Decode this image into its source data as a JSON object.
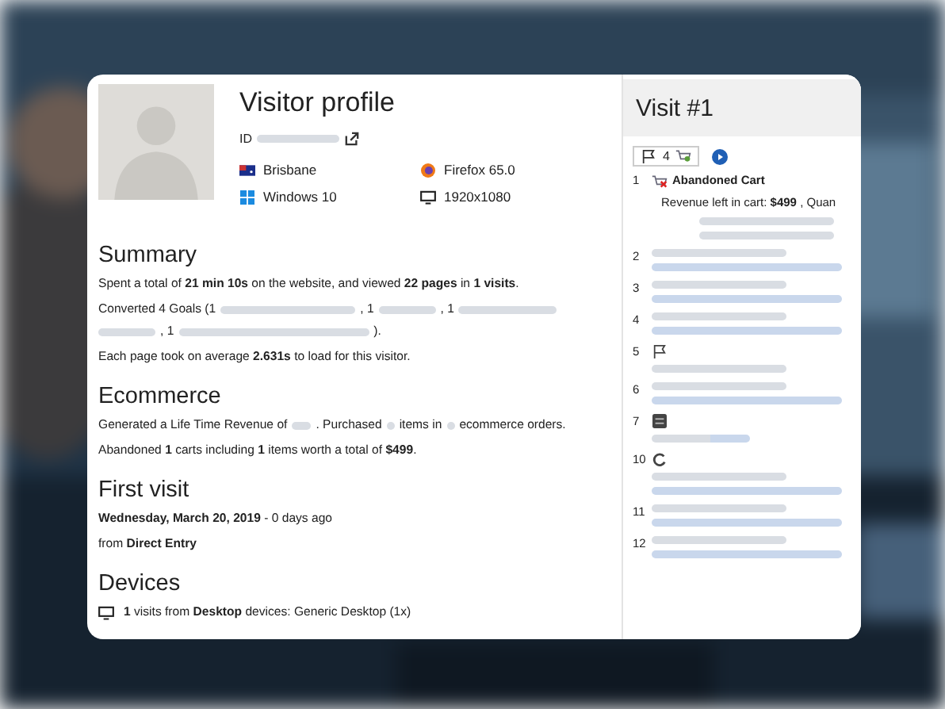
{
  "profile": {
    "title": "Visitor profile",
    "id_label": "ID",
    "location": "Brisbane",
    "browser": "Firefox 65.0",
    "os": "Windows 10",
    "resolution": "1920x1080"
  },
  "sections": [
    {
      "title": "Summary",
      "lines": [
        {
          "kind": "plain",
          "parts": [
            {
              "kind": "text",
              "text": "Spent a total of **21 min 10s** on the website, and viewed **22 pages** in **1 visits**."
            }
          ]
        },
        {
          "kind": "plain",
          "parts": [
            {
              "kind": "text",
              "text": "Converted 4 Goals (1"
            },
            {
              "kind": "redacted"
            },
            {
              "kind": "text",
              "text": ", 1"
            },
            {
              "kind": "redacted"
            },
            {
              "kind": "text",
              "text": ", 1"
            },
            {
              "kind": "redacted"
            },
            {
              "kind": "redacted"
            },
            {
              "kind": "text",
              "text": ", 1"
            },
            {
              "kind": "redacted"
            },
            {
              "kind": "text",
              "text": ")."
            }
          ]
        },
        {
          "kind": "plain",
          "parts": [
            {
              "kind": "text",
              "text": "Each page took on average **2.631s** to load for this visitor."
            }
          ]
        }
      ]
    },
    {
      "title": "Ecommerce",
      "lines": [
        {
          "kind": "plain",
          "parts": [
            {
              "kind": "text",
              "text": "Generated a Life Time Revenue of"
            },
            {
              "kind": "redacted"
            },
            {
              "kind": "text",
              "text": ". Purchased"
            },
            {
              "kind": "redacted"
            },
            {
              "kind": "text",
              "text": "items in"
            },
            {
              "kind": "redacted"
            },
            {
              "kind": "text",
              "text": "ecommerce orders."
            }
          ]
        },
        {
          "kind": "plain",
          "parts": [
            {
              "kind": "text",
              "text": "Abandoned **1** carts including **1** items worth a total of **$499**."
            }
          ]
        }
      ]
    },
    {
      "title": "First visit",
      "lines": [
        {
          "kind": "plain",
          "parts": [
            {
              "kind": "text",
              "text": "**Wednesday, March 20, 2019** - 0 days ago"
            }
          ]
        },
        {
          "kind": "plain",
          "parts": [
            {
              "kind": "text",
              "text": "from **Direct Entry**"
            }
          ]
        }
      ]
    },
    {
      "title": "Devices",
      "lines": [
        {
          "kind": "device",
          "parts": [
            {
              "kind": "text",
              "text": "**1** visits from **Desktop** devices: Generic Desktop (1x)"
            }
          ]
        }
      ]
    }
  ],
  "visit": {
    "title": "Visit #1",
    "goal_count": "4",
    "actions": [
      {
        "number": "1",
        "kind": "cart",
        "title": "Abandoned Cart",
        "detail": "Revenue left in cart: **$499** , Quan",
        "lines": [
          {
            "kind": "title"
          },
          {
            "kind": "title"
          }
        ]
      },
      {
        "number": "2",
        "kind": "page",
        "lines": [
          {
            "kind": "title"
          },
          {
            "kind": "link"
          }
        ]
      },
      {
        "number": "3",
        "kind": "page",
        "lines": [
          {
            "kind": "title"
          },
          {
            "kind": "link"
          }
        ]
      },
      {
        "number": "4",
        "kind": "page",
        "lines": [
          {
            "kind": "title"
          },
          {
            "kind": "link"
          }
        ]
      },
      {
        "number": "5",
        "kind": "goal",
        "lines": [
          {
            "kind": "title"
          }
        ]
      },
      {
        "number": "6",
        "kind": "page",
        "lines": [
          {
            "kind": "title"
          },
          {
            "kind": "link"
          }
        ]
      },
      {
        "number": "7",
        "kind": "form",
        "lines": [
          {
            "kind": "mixed"
          }
        ]
      },
      {
        "number": "10",
        "kind": "return",
        "lines": [
          {
            "kind": "title"
          },
          {
            "kind": "link"
          }
        ]
      },
      {
        "number": "11",
        "kind": "page",
        "lines": [
          {
            "kind": "title"
          },
          {
            "kind": "link"
          }
        ]
      },
      {
        "number": "12",
        "kind": "page",
        "lines": [
          {
            "kind": "title"
          },
          {
            "kind": "link"
          }
        ]
      }
    ]
  }
}
